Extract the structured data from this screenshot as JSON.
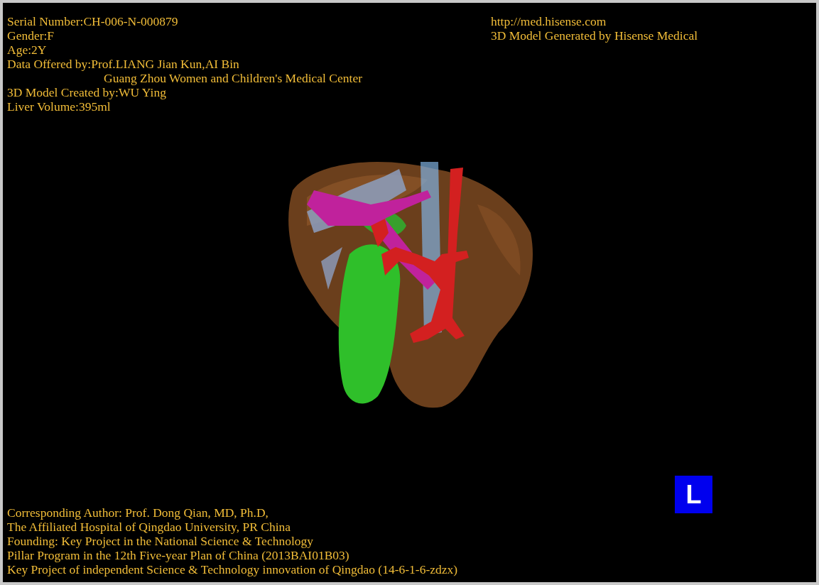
{
  "top_left_info": [
    {
      "kind": "line",
      "text": "Serial Number:CH-006-N-000879"
    },
    {
      "kind": "line",
      "text": "Gender:F"
    },
    {
      "kind": "line",
      "text": "Age:2Y"
    },
    {
      "kind": "line",
      "text": "Data Offered by:Prof.LIANG Jian Kun,AI Bin"
    },
    {
      "kind": "continuation",
      "text": "Guang Zhou Women and Children's Medical Center"
    },
    {
      "kind": "line",
      "text": "3D Model Created by:WU Ying"
    },
    {
      "kind": "line",
      "text": "Liver Volume:395ml"
    }
  ],
  "top_right_info": [
    "http://med.hisense.com",
    "3D Model Generated by Hisense Medical"
  ],
  "bottom_info": [
    "Corresponding Author: Prof. Dong Qian, MD, Ph.D,",
    "The Affiliated Hospital of Qingdao University, PR China",
    "Founding: Key Project in the National Science & Technology",
    "Pillar Program in the 12th Five-year Plan of China (2013BAI01B03)",
    "Key Project of independent Science & Technology innovation of Qingdao (14-6-1-6-zdzx)"
  ],
  "orientation_marker": "L"
}
